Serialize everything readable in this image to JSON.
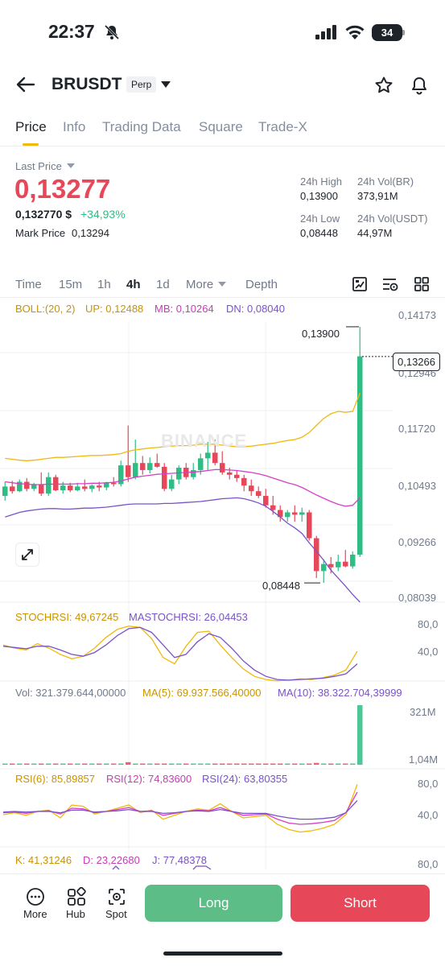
{
  "status": {
    "time": "22:37",
    "battery": "34"
  },
  "header": {
    "symbol": "BRUSDT",
    "badge": "Perp"
  },
  "tabs": [
    "Price",
    "Info",
    "Trading Data",
    "Square",
    "Trade-X"
  ],
  "price": {
    "label": "Last Price",
    "last": "0,13277",
    "usd": "0,132770 $",
    "change": "+34,93%",
    "mark_label": "Mark Price",
    "mark": "0,13294"
  },
  "stats": {
    "high_label": "24h High",
    "high": "0,13900",
    "vol_br_label": "24h Vol(BR)",
    "vol_br": "373,91M",
    "low_label": "24h Low",
    "low": "0,08448",
    "vol_usdt_label": "24h Vol(USDT)",
    "vol_usdt": "44,97M"
  },
  "timeframes": {
    "time": "Time",
    "m15": "15m",
    "h1": "1h",
    "h4": "4h",
    "d1": "1d",
    "more": "More",
    "depth": "Depth",
    "active": "4h"
  },
  "indicators": {
    "boll": {
      "name": "BOLL:(20, 2)",
      "up": "UP: 0,12488",
      "mb": "MB: 0,10264",
      "dn": "DN: 0,08040"
    },
    "stochrsi": {
      "k": "STOCHRSI: 49,67245",
      "ma": "MASTOCHRSI: 26,04453"
    },
    "vol": {
      "vol": "Vol: 321.379.644,00000",
      "ma5": "MA(5): 69.937.566,40000",
      "ma10": "MA(10): 38.322.704,39999"
    },
    "rsi": {
      "r6": "RSI(6): 85,89857",
      "r12": "RSI(12): 74,83600",
      "r24": "RSI(24): 63,80355"
    },
    "kdj": {
      "k": "K: 41,31246",
      "d": "D: 23,22680",
      "j": "J: 77,48378"
    }
  },
  "axis": {
    "price": [
      "0,14173",
      "0,12946",
      "0,11720",
      "0,10493",
      "0,09266",
      "0,08039"
    ],
    "stoch": [
      "80,0",
      "40,0"
    ],
    "vol": [
      "321M",
      "1,04M"
    ],
    "rsi": [
      "80,0",
      "40,0"
    ],
    "kdj": [
      "80,0"
    ]
  },
  "chart_labels": {
    "current": "0,13266",
    "high": "0,13900",
    "low": "0,08448",
    "watermark": "BINANCE"
  },
  "colors": {
    "up": "#2ebd85",
    "down": "#e6485a",
    "boll_up": "#f0b90b",
    "boll_mb": "#d63fc5",
    "boll_dn": "#7a52c7",
    "accent": "#f0b90b"
  },
  "bottom": {
    "more": "More",
    "hub": "Hub",
    "spot": "Spot",
    "long": "Long",
    "short": "Short"
  }
}
